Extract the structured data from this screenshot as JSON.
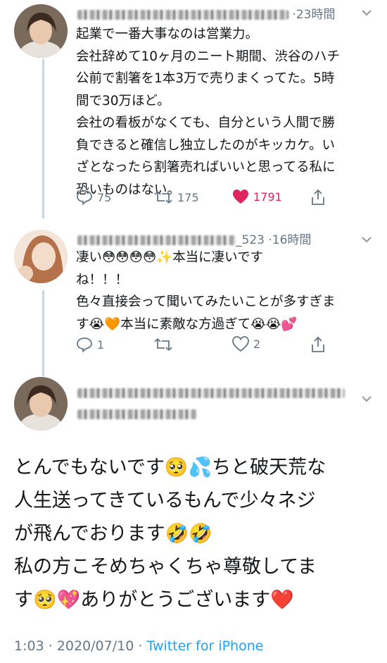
{
  "tweets": [
    {
      "name_blurred": "[blurred name]",
      "handle_suffix": "",
      "time": "·23時間",
      "text": "起業で一番大事なのは営業力。\n会社辞めて10ヶ月のニート期間、渋谷のハチ\n公前で割箸を1本3万で売りまくってた。5時\n間で30万ほど。\n会社の看板がなくても、自分という人間で勝\n負できると確信し独立したのがキッカケ。い\nざとなったら割箸売ればいいと思ってる私に\n恐いものはない。",
      "replies": "75",
      "retweets": "175",
      "likes": "1791",
      "liked": true
    },
    {
      "name_blurred": "[blurred name]",
      "handle_suffix": "_523",
      "time": "·16時間",
      "text": "凄い😳😳😳😳✨本当に凄いです\nね！！！\n色々直接会って聞いてみたいことが多すぎま\nす😭🧡本当に素敵な方過ぎて😭😭💕",
      "replies": "1",
      "retweets": "",
      "likes": "2",
      "liked": false
    }
  ],
  "main_tweet": {
    "text": "とんでもないです🥺💦ちと破天荒な\n人生送ってきているもんで少々ネジ\nが飛んでおります🤣🤣\n私の方こそめちゃくちゃ尊敬してま\nす🥺💖ありがとうございます❤️",
    "time": "1:03",
    "date": "2020/07/10",
    "source": "Twitter for iPhone"
  },
  "icons": {
    "reply": "reply-icon",
    "retweet": "retweet-icon",
    "like": "heart-icon",
    "share": "share-icon",
    "menu": "chevron-down-icon"
  },
  "colors": {
    "accent": "#1da1f2",
    "like": "#e0245e",
    "secondary": "#657786",
    "thread_line": "#ccd6dd"
  }
}
